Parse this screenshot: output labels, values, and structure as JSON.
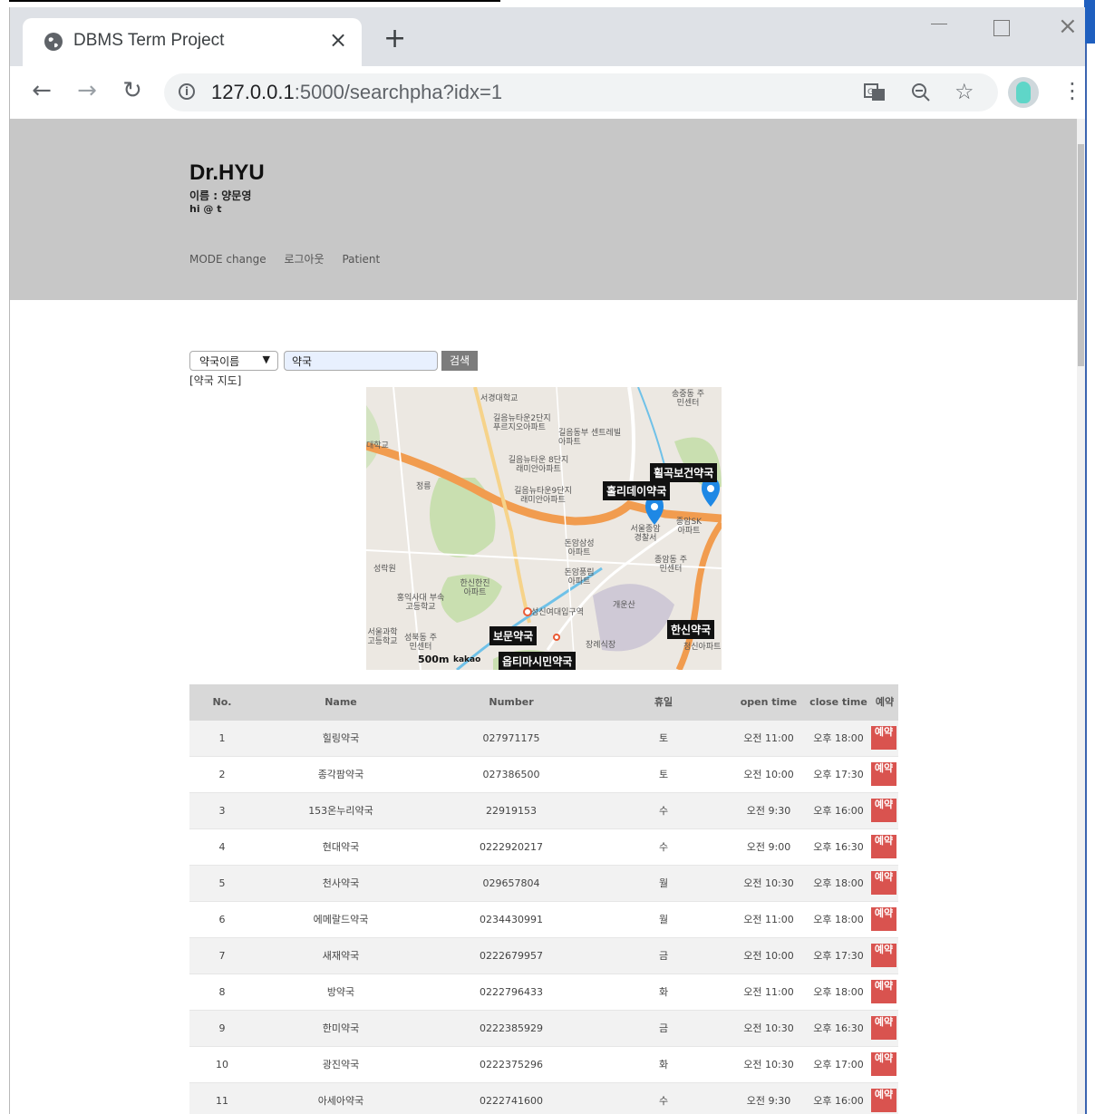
{
  "browser": {
    "tab_title": "DBMS Term Project",
    "url_host": "127.0.0.1",
    "url_path": ":5000/searchpha?idx=1"
  },
  "header": {
    "brand": "Dr.HYU",
    "user_name": "이름 : 양문영",
    "user_id": "hi @ t",
    "nav": [
      "MODE change",
      "로그아웃",
      "Patient"
    ]
  },
  "search": {
    "select_value": "약국이름",
    "query": "약국",
    "button_label": "검색",
    "map_label": "[약국 지도]"
  },
  "map": {
    "scale": "500m",
    "attribution": "kakao",
    "pharmacy_labels": [
      "휠곡보건약국",
      "홀리데이약국",
      "한신약국",
      "보문약국",
      "옵티마시민약국"
    ],
    "place_labels": [
      "서경대학교",
      "송중동 주민센터",
      "길음뉴타운2단지 푸르지오아파트",
      "길음동부 센트레빌아파트",
      "대학교",
      "길음뉴타운 8단지래미안아파트",
      "길음뉴타운9단지 래미안아파트",
      "정릉",
      "돈암삼성 아파트",
      "돈암풍림 아파트",
      "서울종암 경찰서",
      "종암SK 아파트",
      "종암동 주민센터",
      "성락원",
      "한신한진 아파트",
      "개운산",
      "홍익사대 부속고등학교",
      "성신여대입구역",
      "서울과학 고등학교",
      "성북동 주민센터",
      "성신여대입구역",
      "장례식장",
      "청신아파트"
    ]
  },
  "table": {
    "headers": [
      "No.",
      "Name",
      "Number",
      "휴일",
      "open time",
      "close time",
      "예약"
    ],
    "reserve_label": "예약",
    "rows": [
      {
        "no": "1",
        "name": "힐링약국",
        "number": "027971175",
        "holiday": "토",
        "open": "오전 11:00",
        "close": "오후 18:00"
      },
      {
        "no": "2",
        "name": "종각팜약국",
        "number": "027386500",
        "holiday": "토",
        "open": "오전 10:00",
        "close": "오후 17:30"
      },
      {
        "no": "3",
        "name": "153온누리약국",
        "number": "22919153",
        "holiday": "수",
        "open": "오전 9:30",
        "close": "오후 16:00"
      },
      {
        "no": "4",
        "name": "현대약국",
        "number": "0222920217",
        "holiday": "수",
        "open": "오전 9:00",
        "close": "오후 16:30"
      },
      {
        "no": "5",
        "name": "천사약국",
        "number": "029657804",
        "holiday": "월",
        "open": "오전 10:30",
        "close": "오후 18:00"
      },
      {
        "no": "6",
        "name": "에메랄드약국",
        "number": "0234430991",
        "holiday": "월",
        "open": "오전 11:00",
        "close": "오후 18:00"
      },
      {
        "no": "7",
        "name": "새재약국",
        "number": "0222679957",
        "holiday": "금",
        "open": "오전 10:00",
        "close": "오후 17:30"
      },
      {
        "no": "8",
        "name": "방약국",
        "number": "0222796433",
        "holiday": "화",
        "open": "오전 11:00",
        "close": "오후 18:00"
      },
      {
        "no": "9",
        "name": "한미약국",
        "number": "0222385929",
        "holiday": "금",
        "open": "오전 10:30",
        "close": "오후 16:30"
      },
      {
        "no": "10",
        "name": "광진약국",
        "number": "0222375296",
        "holiday": "화",
        "open": "오전 10:30",
        "close": "오후 17:00"
      },
      {
        "no": "11",
        "name": "아세아약국",
        "number": "0222741600",
        "holiday": "수",
        "open": "오전 9:30",
        "close": "오후 16:00"
      }
    ]
  }
}
